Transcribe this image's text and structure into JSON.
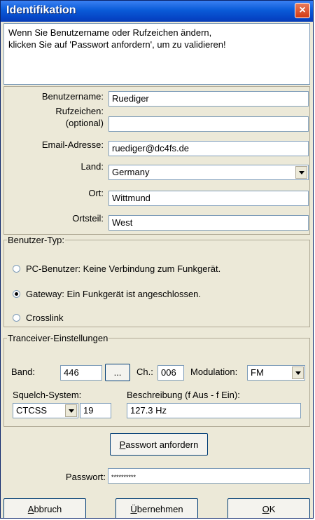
{
  "window": {
    "title": "Identifikation",
    "close_icon": "×"
  },
  "message": {
    "line1": "Wenn Sie Benutzername oder Rufzeichen ändern,",
    "line2": "klicken Sie auf 'Passwort anfordern', um zu validieren!"
  },
  "form": {
    "username_label": "Benutzername:",
    "username_value": "Ruediger",
    "callsign_label_line1": "Rufzeichen:",
    "callsign_label_line2": "(optional)",
    "callsign_value": "",
    "email_label": "Email-Adresse:",
    "email_value": "ruediger@dc4fs.de",
    "country_label": "Land:",
    "country_value": "Germany",
    "city_label": "Ort:",
    "city_value": "Wittmund",
    "district_label": "Ortsteil:",
    "district_value": "West"
  },
  "user_type": {
    "legend": "Benutzer-Typ:",
    "options": [
      {
        "label": "PC-Benutzer: Keine Verbindung zum Funkgerät.",
        "selected": false
      },
      {
        "label": "Gateway: Ein Funkgerät ist angeschlossen.",
        "selected": true
      },
      {
        "label": "Crosslink",
        "selected": false
      }
    ]
  },
  "transceiver": {
    "legend": "Tranceiver-Einstellungen",
    "band_label": "Band:",
    "band_value": "446",
    "browse_label": "...",
    "channel_label": "Ch.:",
    "channel_value": "006",
    "modulation_label": "Modulation:",
    "modulation_value": "FM",
    "squelch_label": "Squelch-System:",
    "squelch_value": "CTCSS",
    "squelch_number": "19",
    "description_label": "Beschreibung (f Aus - f Ein):",
    "description_value": "127.3 Hz"
  },
  "request_password": {
    "pre": "",
    "accel": "P",
    "post": "asswort anfordern"
  },
  "password": {
    "label": "Passwort:",
    "value": "**********"
  },
  "buttons": {
    "cancel": {
      "accel": "A",
      "post": "bbruch"
    },
    "apply": {
      "accel": "Ü",
      "post": "bernehmen"
    },
    "ok": {
      "accel": "O",
      "post": "K"
    }
  },
  "colors": {
    "titlebar": "#0a5bd8",
    "close": "#d23a12",
    "window_bg": "#ece9d8"
  }
}
